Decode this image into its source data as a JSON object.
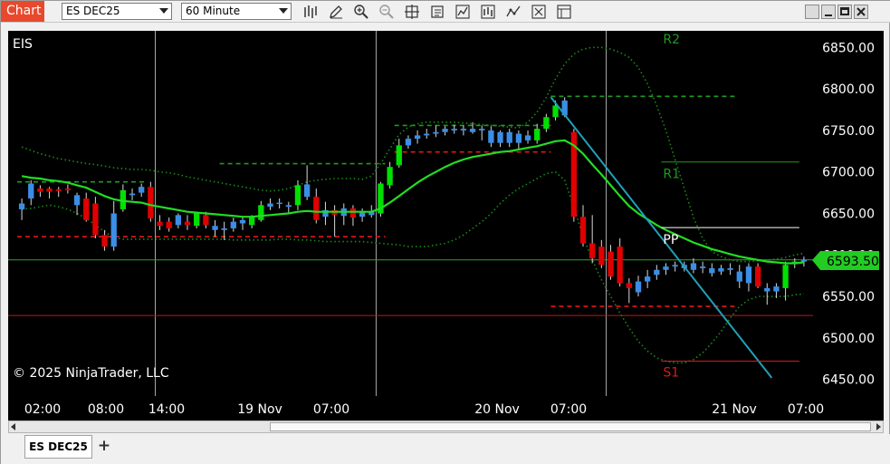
{
  "toolbar": {
    "tab_label": "Chart",
    "instrument": "ES DEC25",
    "interval": "60 Minute",
    "icons": [
      "bars-icon",
      "pencil-draw-icon",
      "zoom-in-icon",
      "zoom-out-icon",
      "crosshair-icon",
      "properties-icon",
      "indicators-icon",
      "strategies-icon",
      "trend-icon",
      "data-box-icon",
      "template-icon"
    ],
    "window_buttons": [
      "restore-icon",
      "minimize-icon",
      "maximize-icon",
      "close-icon"
    ]
  },
  "chart": {
    "symbol_label": "EIS",
    "copyright": "© 2025 NinjaTrader, LLC",
    "current_price": "6593.50",
    "colors": {
      "background": "#000000",
      "up": "#00e000",
      "down": "#e00000",
      "neutral": "#3a8ee6",
      "sma": "#22dd22",
      "band": "#1a8a1a",
      "trendline": "#20a0b8",
      "price_badge": "#22cc22"
    },
    "pivot_labels": {
      "r2": "R2",
      "r1": "R1",
      "pp": "PP",
      "s1": "S1"
    }
  },
  "chart_data": {
    "type": "line",
    "ylim": [
      6430,
      6870
    ],
    "y_ticks": [
      "6850.00",
      "6800.00",
      "6750.00",
      "6700.00",
      "6650.00",
      "6600.00",
      "6550.00",
      "6500.00",
      "6450.00"
    ],
    "x_ticks": [
      "02:00",
      "08:00",
      "14:00",
      "19 Nov",
      "07:00",
      "20 Nov",
      "07:00",
      "21 Nov",
      "07:00"
    ],
    "candles": [
      {
        "o": 6655,
        "h": 6668,
        "l": 6642,
        "c": 6662,
        "d": "n"
      },
      {
        "o": 6668,
        "h": 6690,
        "l": 6660,
        "c": 6686,
        "d": "n"
      },
      {
        "o": 6676,
        "h": 6684,
        "l": 6670,
        "c": 6680,
        "d": "d"
      },
      {
        "o": 6676,
        "h": 6682,
        "l": 6668,
        "c": 6680,
        "d": "d"
      },
      {
        "o": 6677,
        "h": 6682,
        "l": 6670,
        "c": 6679,
        "d": "d"
      },
      {
        "o": 6680,
        "h": 6685,
        "l": 6674,
        "c": 6678,
        "d": "d"
      },
      {
        "o": 6660,
        "h": 6675,
        "l": 6648,
        "c": 6672,
        "d": "n"
      },
      {
        "o": 6668,
        "h": 6675,
        "l": 6640,
        "c": 6642,
        "d": "d"
      },
      {
        "o": 6662,
        "h": 6670,
        "l": 6620,
        "c": 6624,
        "d": "d"
      },
      {
        "o": 6624,
        "h": 6630,
        "l": 6605,
        "c": 6610,
        "d": "d"
      },
      {
        "o": 6610,
        "h": 6665,
        "l": 6605,
        "c": 6650,
        "d": "n"
      },
      {
        "o": 6655,
        "h": 6685,
        "l": 6652,
        "c": 6678,
        "d": "u"
      },
      {
        "o": 6672,
        "h": 6680,
        "l": 6666,
        "c": 6674,
        "d": "n"
      },
      {
        "o": 6675,
        "h": 6686,
        "l": 6670,
        "c": 6682,
        "d": "n"
      },
      {
        "o": 6682,
        "h": 6688,
        "l": 6640,
        "c": 6644,
        "d": "d"
      },
      {
        "o": 6640,
        "h": 6648,
        "l": 6630,
        "c": 6635,
        "d": "d"
      },
      {
        "o": 6640,
        "h": 6645,
        "l": 6628,
        "c": 6632,
        "d": "d"
      },
      {
        "o": 6636,
        "h": 6650,
        "l": 6632,
        "c": 6648,
        "d": "n"
      },
      {
        "o": 6640,
        "h": 6648,
        "l": 6630,
        "c": 6636,
        "d": "d"
      },
      {
        "o": 6635,
        "h": 6652,
        "l": 6632,
        "c": 6650,
        "d": "u"
      },
      {
        "o": 6648,
        "h": 6652,
        "l": 6632,
        "c": 6636,
        "d": "d"
      },
      {
        "o": 6635,
        "h": 6642,
        "l": 6622,
        "c": 6630,
        "d": "n"
      },
      {
        "o": 6630,
        "h": 6640,
        "l": 6618,
        "c": 6632,
        "d": "n"
      },
      {
        "o": 6632,
        "h": 6645,
        "l": 6628,
        "c": 6640,
        "d": "n"
      },
      {
        "o": 6638,
        "h": 6646,
        "l": 6630,
        "c": 6642,
        "d": "n"
      },
      {
        "o": 6636,
        "h": 6648,
        "l": 6632,
        "c": 6646,
        "d": "u"
      },
      {
        "o": 6642,
        "h": 6665,
        "l": 6640,
        "c": 6660,
        "d": "u"
      },
      {
        "o": 6658,
        "h": 6668,
        "l": 6654,
        "c": 6662,
        "d": "n"
      },
      {
        "o": 6662,
        "h": 6668,
        "l": 6656,
        "c": 6663,
        "d": "n"
      },
      {
        "o": 6658,
        "h": 6664,
        "l": 6650,
        "c": 6660,
        "d": "n"
      },
      {
        "o": 6660,
        "h": 6690,
        "l": 6654,
        "c": 6684,
        "d": "u"
      },
      {
        "o": 6685,
        "h": 6708,
        "l": 6666,
        "c": 6670,
        "d": "n"
      },
      {
        "o": 6670,
        "h": 6680,
        "l": 6638,
        "c": 6642,
        "d": "d"
      },
      {
        "o": 6646,
        "h": 6664,
        "l": 6636,
        "c": 6654,
        "d": "n"
      },
      {
        "o": 6654,
        "h": 6660,
        "l": 6622,
        "c": 6648,
        "d": "d"
      },
      {
        "o": 6647,
        "h": 6662,
        "l": 6636,
        "c": 6656,
        "d": "n"
      },
      {
        "o": 6656,
        "h": 6660,
        "l": 6635,
        "c": 6645,
        "d": "d"
      },
      {
        "o": 6646,
        "h": 6656,
        "l": 6640,
        "c": 6652,
        "d": "n"
      },
      {
        "o": 6652,
        "h": 6660,
        "l": 6645,
        "c": 6648,
        "d": "n"
      },
      {
        "o": 6650,
        "h": 6688,
        "l": 6646,
        "c": 6686,
        "d": "u"
      },
      {
        "o": 6684,
        "h": 6712,
        "l": 6680,
        "c": 6706,
        "d": "u"
      },
      {
        "o": 6708,
        "h": 6740,
        "l": 6705,
        "c": 6732,
        "d": "u"
      },
      {
        "o": 6732,
        "h": 6744,
        "l": 6728,
        "c": 6740,
        "d": "n"
      },
      {
        "o": 6740,
        "h": 6750,
        "l": 6734,
        "c": 6744,
        "d": "n"
      },
      {
        "o": 6744,
        "h": 6752,
        "l": 6740,
        "c": 6746,
        "d": "n"
      },
      {
        "o": 6746,
        "h": 6756,
        "l": 6742,
        "c": 6748,
        "d": "n"
      },
      {
        "o": 6748,
        "h": 6755,
        "l": 6744,
        "c": 6752,
        "d": "n"
      },
      {
        "o": 6752,
        "h": 6757,
        "l": 6746,
        "c": 6750,
        "d": "n"
      },
      {
        "o": 6750,
        "h": 6756,
        "l": 6744,
        "c": 6752,
        "d": "n"
      },
      {
        "o": 6752,
        "h": 6760,
        "l": 6746,
        "c": 6748,
        "d": "n"
      },
      {
        "o": 6750,
        "h": 6756,
        "l": 6738,
        "c": 6752,
        "d": "n"
      },
      {
        "o": 6750,
        "h": 6755,
        "l": 6730,
        "c": 6735,
        "d": "n"
      },
      {
        "o": 6735,
        "h": 6750,
        "l": 6730,
        "c": 6748,
        "d": "n"
      },
      {
        "o": 6748,
        "h": 6752,
        "l": 6730,
        "c": 6735,
        "d": "n"
      },
      {
        "o": 6735,
        "h": 6750,
        "l": 6728,
        "c": 6746,
        "d": "n"
      },
      {
        "o": 6744,
        "h": 6750,
        "l": 6734,
        "c": 6738,
        "d": "n"
      },
      {
        "o": 6738,
        "h": 6758,
        "l": 6734,
        "c": 6752,
        "d": "u"
      },
      {
        "o": 6752,
        "h": 6770,
        "l": 6748,
        "c": 6766,
        "d": "u"
      },
      {
        "o": 6766,
        "h": 6786,
        "l": 6762,
        "c": 6780,
        "d": "u"
      },
      {
        "o": 6786,
        "h": 6790,
        "l": 6766,
        "c": 6768,
        "d": "n"
      },
      {
        "o": 6748,
        "h": 6752,
        "l": 6640,
        "c": 6646,
        "d": "d"
      },
      {
        "o": 6646,
        "h": 6660,
        "l": 6610,
        "c": 6614,
        "d": "d"
      },
      {
        "o": 6614,
        "h": 6648,
        "l": 6590,
        "c": 6596,
        "d": "d"
      },
      {
        "o": 6610,
        "h": 6618,
        "l": 6584,
        "c": 6588,
        "d": "d"
      },
      {
        "o": 6604,
        "h": 6612,
        "l": 6570,
        "c": 6574,
        "d": "d"
      },
      {
        "o": 6610,
        "h": 6620,
        "l": 6562,
        "c": 6566,
        "d": "d"
      },
      {
        "o": 6566,
        "h": 6572,
        "l": 6542,
        "c": 6560,
        "d": "d"
      },
      {
        "o": 6555,
        "h": 6575,
        "l": 6550,
        "c": 6568,
        "d": "n"
      },
      {
        "o": 6568,
        "h": 6582,
        "l": 6560,
        "c": 6574,
        "d": "n"
      },
      {
        "o": 6576,
        "h": 6588,
        "l": 6570,
        "c": 6582,
        "d": "n"
      },
      {
        "o": 6582,
        "h": 6590,
        "l": 6576,
        "c": 6586,
        "d": "n"
      },
      {
        "o": 6586,
        "h": 6592,
        "l": 6580,
        "c": 6588,
        "d": "n"
      },
      {
        "o": 6588,
        "h": 6592,
        "l": 6580,
        "c": 6584,
        "d": "n"
      },
      {
        "o": 6582,
        "h": 6596,
        "l": 6578,
        "c": 6590,
        "d": "n"
      },
      {
        "o": 6586,
        "h": 6592,
        "l": 6578,
        "c": 6584,
        "d": "n"
      },
      {
        "o": 6584,
        "h": 6590,
        "l": 6574,
        "c": 6578,
        "d": "n"
      },
      {
        "o": 6580,
        "h": 6588,
        "l": 6576,
        "c": 6584,
        "d": "n"
      },
      {
        "o": 6584,
        "h": 6590,
        "l": 6576,
        "c": 6582,
        "d": "n"
      },
      {
        "o": 6580,
        "h": 6588,
        "l": 6560,
        "c": 6568,
        "d": "n"
      },
      {
        "o": 6566,
        "h": 6590,
        "l": 6556,
        "c": 6586,
        "d": "n"
      },
      {
        "o": 6586,
        "h": 6590,
        "l": 6560,
        "c": 6562,
        "d": "d"
      },
      {
        "o": 6560,
        "h": 6566,
        "l": 6540,
        "c": 6556,
        "d": "n"
      },
      {
        "o": 6556,
        "h": 6566,
        "l": 6548,
        "c": 6562,
        "d": "n"
      },
      {
        "o": 6560,
        "h": 6592,
        "l": 6545,
        "c": 6588,
        "d": "u"
      },
      {
        "o": 6590,
        "h": 6596,
        "l": 6584,
        "c": 6592,
        "d": "u"
      },
      {
        "o": 6592,
        "h": 6598,
        "l": 6586,
        "c": 6594,
        "d": "n"
      }
    ],
    "sma": [
      6695,
      6693,
      6692,
      6690,
      6689,
      6687,
      6684,
      6681,
      6676,
      6671,
      6667,
      6665,
      6664,
      6663,
      6660,
      6658,
      6656,
      6654,
      6652,
      6651,
      6650,
      6649,
      6648,
      6647,
      6646,
      6646,
      6647,
      6648,
      6649,
      6650,
      6652,
      6653,
      6652,
      6652,
      6652,
      6652,
      6652,
      6652,
      6652,
      6656,
      6663,
      6671,
      6679,
      6687,
      6694,
      6700,
      6706,
      6711,
      6715,
      6718,
      6720,
      6722,
      6724,
      6725,
      6727,
      6729,
      6731,
      6734,
      6737,
      6738,
      6732,
      6722,
      6709,
      6697,
      6684,
      6671,
      6659,
      6650,
      6643,
      6636,
      6630,
      6625,
      6620,
      6615,
      6611,
      6607,
      6604,
      6601,
      6598,
      6596,
      6594,
      6592,
      6591,
      6590,
      6590,
      6591
    ],
    "upper_band": [
      6730,
      6726,
      6722,
      6719,
      6716,
      6714,
      6712,
      6710,
      6709,
      6707,
      6705,
      6704,
      6703,
      6703,
      6702,
      6700,
      6699,
      6697,
      6694,
      6692,
      6690,
      6688,
      6686,
      6684,
      6682,
      6680,
      6678,
      6677,
      6678,
      6680,
      6684,
      6688,
      6690,
      6691,
      6692,
      6692,
      6692,
      6691,
      6695,
      6710,
      6728,
      6745,
      6754,
      6758,
      6760,
      6760,
      6760,
      6760,
      6759,
      6758,
      6757,
      6756,
      6755,
      6754,
      6753,
      6760,
      6772,
      6790,
      6812,
      6830,
      6842,
      6848,
      6850,
      6850,
      6848,
      6844,
      6838,
      6826,
      6806,
      6780,
      6750,
      6715,
      6680,
      6645,
      6620,
      6604,
      6598,
      6594,
      6592,
      6592,
      6593,
      6594,
      6595,
      6597,
      6600,
      6602
    ],
    "lower_band": [
      6655,
      6656,
      6658,
      6660,
      6658,
      6655,
      6650,
      6644,
      6636,
      6628,
      6621,
      6619,
      6619,
      6619,
      6619,
      6619,
      6619,
      6619,
      6619,
      6619,
      6619,
      6619,
      6619,
      6618,
      6618,
      6618,
      6618,
      6618,
      6619,
      6619,
      6618,
      6618,
      6617,
      6616,
      6616,
      6616,
      6616,
      6616,
      6615,
      6614,
      6613,
      6612,
      6610,
      6610,
      6610,
      6612,
      6614,
      6618,
      6624,
      6632,
      6640,
      6650,
      6662,
      6672,
      6680,
      6686,
      6692,
      6698,
      6700,
      6690,
      6658,
      6622,
      6594,
      6570,
      6550,
      6530,
      6512,
      6496,
      6484,
      6476,
      6472,
      6470,
      6470,
      6474,
      6482,
      6494,
      6508,
      6524,
      6538,
      6546,
      6550,
      6550,
      6550,
      6550,
      6552,
      6553
    ],
    "pivots": [
      {
        "label": "R2",
        "price": 6790,
        "from": 58,
        "to": 84
      },
      {
        "label": "R1",
        "price": 6712,
        "from": 70,
        "to": 85
      },
      {
        "label": "PP",
        "price": 6633,
        "from": 70,
        "to": 85
      },
      {
        "label": "S1",
        "price": 6472,
        "from": 70,
        "to": 85
      }
    ],
    "prior_levels": [
      {
        "price": 6688,
        "from": 0,
        "to": 14,
        "color": "green"
      },
      {
        "price": 6622,
        "from": 0,
        "to": 40,
        "color": "red"
      },
      {
        "price": 6710,
        "from": 22,
        "to": 40,
        "color": "green"
      },
      {
        "price": 6756,
        "from": 41,
        "to": 58,
        "color": "green"
      },
      {
        "price": 6724,
        "from": 41,
        "to": 58,
        "color": "red"
      },
      {
        "price": 6791,
        "from": 58,
        "to": 78,
        "color": "green"
      },
      {
        "price": 6538,
        "from": 58,
        "to": 78,
        "color": "red"
      }
    ],
    "hlines": [
      {
        "price": 6594,
        "color": "#2ca62c"
      },
      {
        "price": 6527,
        "color": "#c01818"
      }
    ],
    "trendline": {
      "from": [
        58,
        6790
      ],
      "to": [
        82,
        6452
      ]
    },
    "session_dividers": [
      15,
      39,
      64
    ]
  },
  "bottom": {
    "instrument_tab": "ES DEC25",
    "add_tab": "+"
  }
}
